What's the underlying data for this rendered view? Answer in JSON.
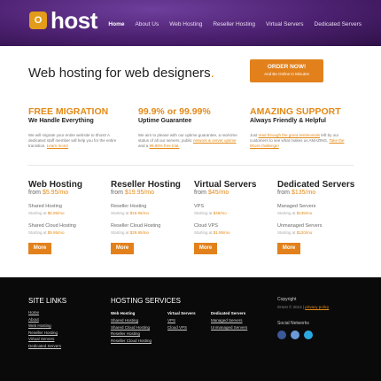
{
  "logo": {
    "mark": "O",
    "text": "host"
  },
  "nav": [
    "Home",
    "About Us",
    "Web Hosting",
    "Reseller Hosting",
    "Virtual Servers",
    "Dedicated Servers"
  ],
  "hero": {
    "title": "Web hosting for web designers",
    "dot": ".",
    "order_l1": "ORDER NOW!",
    "order_l2": "And Be Online in Minutes"
  },
  "features": [
    {
      "title": "FREE MIGRATION",
      "subtitle": "We Handle Everything",
      "desc": "We will migrate your entire website to 0host! A dedicated staff member will help you for the entire transition.",
      "link": "Learn more!"
    },
    {
      "title": "99.9% or 99.99%",
      "subtitle": "Uptime Guarantee",
      "desc": "We aim to please with our uptime guarantee, a real-time status of all our servers, public",
      "link": "network & server uptime",
      "desc2": "and a",
      "link2": "99.99% free trial."
    },
    {
      "title": "AMAZING SUPPORT",
      "subtitle": "Always Friendly & Helpful",
      "desc": "Just",
      "link": "read through the great testimonials",
      "desc2": "left by our customers to see what makes us AMAZING.",
      "link2": "Take the 0host challenge!"
    }
  ],
  "plans": [
    {
      "title": "Web Hosting",
      "from": "from",
      "price": "$5.95/mo",
      "rows": [
        {
          "name": "Shared Hosting",
          "start": "Starting at",
          "price": "$5.95/mo"
        },
        {
          "name": "Shared Cloud Hosting",
          "start": "Starting at",
          "price": "$9.95/mo"
        }
      ]
    },
    {
      "title": "Reseller Hosting",
      "from": "from",
      "price": "$19.95/mo",
      "rows": [
        {
          "name": "Reseller Hosting",
          "start": "Starting at",
          "price": "$19.95/mo"
        },
        {
          "name": "Reseller Cloud Hosting",
          "start": "Starting at",
          "price": "$29.95/mo"
        }
      ]
    },
    {
      "title": "Virtual Servers",
      "from": "from",
      "price": "$45/mo",
      "rows": [
        {
          "name": "VPS",
          "start": "Starting at",
          "price": "$45/mo"
        },
        {
          "name": "Cloud VPS",
          "start": "Starting at",
          "price": "$1.95/mo"
        }
      ]
    },
    {
      "title": "Dedicated Servers",
      "from": "from",
      "price": "$135/mo",
      "rows": [
        {
          "name": "Managed Servers",
          "start": "Starting at",
          "price": "$135/mo"
        },
        {
          "name": "Unmanaged Servers",
          "start": "Starting at",
          "price": "$120/mo"
        }
      ]
    }
  ],
  "more_label": "More",
  "footer": {
    "site_links_title": "SITE LINKS",
    "site_links": [
      "Home",
      "About",
      "Web Hosting",
      "Reseller Hosting",
      "Virtual Servers",
      "Dedicated Servers"
    ],
    "hosting_title": "HOSTING SERVICES",
    "hosting_cols": [
      {
        "head": "Web Hosting",
        "links": [
          "Shared Hosting",
          "Shared Cloud Hosting",
          "Reseller Hosting",
          "Reseller Cloud Hosting"
        ]
      },
      {
        "head": "Virtual Servers",
        "links": [
          "VPS",
          "Cloud VPS"
        ]
      },
      {
        "head": "Dedicated Servers",
        "links": [
          "Managed Servers",
          "Unmanaged Servers"
        ]
      }
    ],
    "copyright_label": "Copyright",
    "copyright_text": "0Host © 2013 |",
    "privacy_link": "privacy policy",
    "social_label": "Social Networks",
    "social_colors": [
      "#3b5998",
      "#6a9bd8",
      "#2aa9e0"
    ]
  }
}
